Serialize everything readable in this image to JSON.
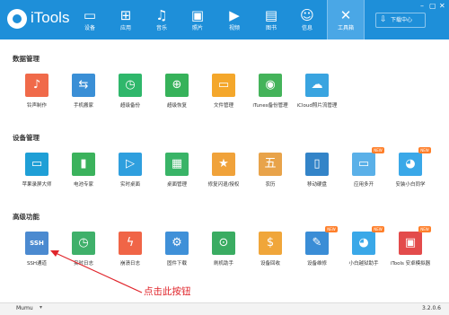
{
  "app": {
    "name": "iTools"
  },
  "nav": {
    "tabs": [
      {
        "label": "设备",
        "glyph": "▭"
      },
      {
        "label": "应用",
        "glyph": "⊞"
      },
      {
        "label": "音乐",
        "glyph": "♫"
      },
      {
        "label": "照片",
        "glyph": "▣"
      },
      {
        "label": "视频",
        "glyph": "▶"
      },
      {
        "label": "图书",
        "glyph": "▤"
      },
      {
        "label": "信息",
        "glyph": "☺"
      },
      {
        "label": "工具箱",
        "glyph": "✕"
      }
    ],
    "download_label": "下载中心"
  },
  "sections": [
    {
      "title": "数据管理",
      "items": [
        {
          "label": "铃声制作",
          "color": "#f06a4a",
          "glyph": "♪"
        },
        {
          "label": "手机搬家",
          "color": "#3a8fd6",
          "glyph": "⇆"
        },
        {
          "label": "超级备份",
          "color": "#2fb76b",
          "glyph": "◷"
        },
        {
          "label": "超级恢复",
          "color": "#36b25a",
          "glyph": "⊕"
        },
        {
          "label": "文件管理",
          "color": "#f4a72b",
          "glyph": "▭"
        },
        {
          "label": "iTunes备份管理",
          "color": "#44b35a",
          "glyph": "◉"
        },
        {
          "label": "iCloud照片流管理",
          "color": "#39a4e0",
          "glyph": "☁"
        }
      ]
    },
    {
      "title": "设备管理",
      "items": [
        {
          "label": "苹果录屏大师",
          "color": "#1f9fd6",
          "glyph": "▭"
        },
        {
          "label": "电池专家",
          "color": "#3bb25c",
          "glyph": "▮"
        },
        {
          "label": "实时桌面",
          "color": "#2f9fde",
          "glyph": "▷"
        },
        {
          "label": "桌面管理",
          "color": "#39b467",
          "glyph": "▦"
        },
        {
          "label": "修复闪退/授权",
          "color": "#f0a23a",
          "glyph": "★"
        },
        {
          "label": "农历",
          "color": "#e8a34a",
          "glyph": "五"
        },
        {
          "label": "移动硬盘",
          "color": "#3384c8",
          "glyph": "▯"
        },
        {
          "label": "应用多开",
          "color": "#5ab0e8",
          "glyph": "▭",
          "badge": "NEW"
        },
        {
          "label": "安装小白同学",
          "color": "#3aa8e8",
          "glyph": "◕",
          "badge": "NEW"
        }
      ]
    },
    {
      "title": "高级功能",
      "items": [
        {
          "label": "SSH通道",
          "color": "#4b8ad0",
          "glyph": "SSH"
        },
        {
          "label": "实时日志",
          "color": "#3fb06a",
          "glyph": "◷"
        },
        {
          "label": "崩溃日志",
          "color": "#f06547",
          "glyph": "ϟ"
        },
        {
          "label": "固件下载",
          "color": "#3f90d8",
          "glyph": "⚙"
        },
        {
          "label": "刷机助手",
          "color": "#3aac62",
          "glyph": "⊙"
        },
        {
          "label": "设备回收",
          "color": "#f0a63a",
          "glyph": "$"
        },
        {
          "label": "设备维修",
          "color": "#3a8dd6",
          "glyph": "✎",
          "badge": "NEW"
        },
        {
          "label": "小白越狱助手",
          "color": "#3aa8e8",
          "glyph": "◕",
          "badge": "NEW"
        },
        {
          "label": "iTools 安卓模拟器",
          "color": "#e34b4b",
          "glyph": "▣",
          "badge": "NEW"
        }
      ]
    }
  ],
  "annotation": "点击此按钮",
  "status": {
    "device": "Mumu",
    "version": "3.2.0.6"
  }
}
